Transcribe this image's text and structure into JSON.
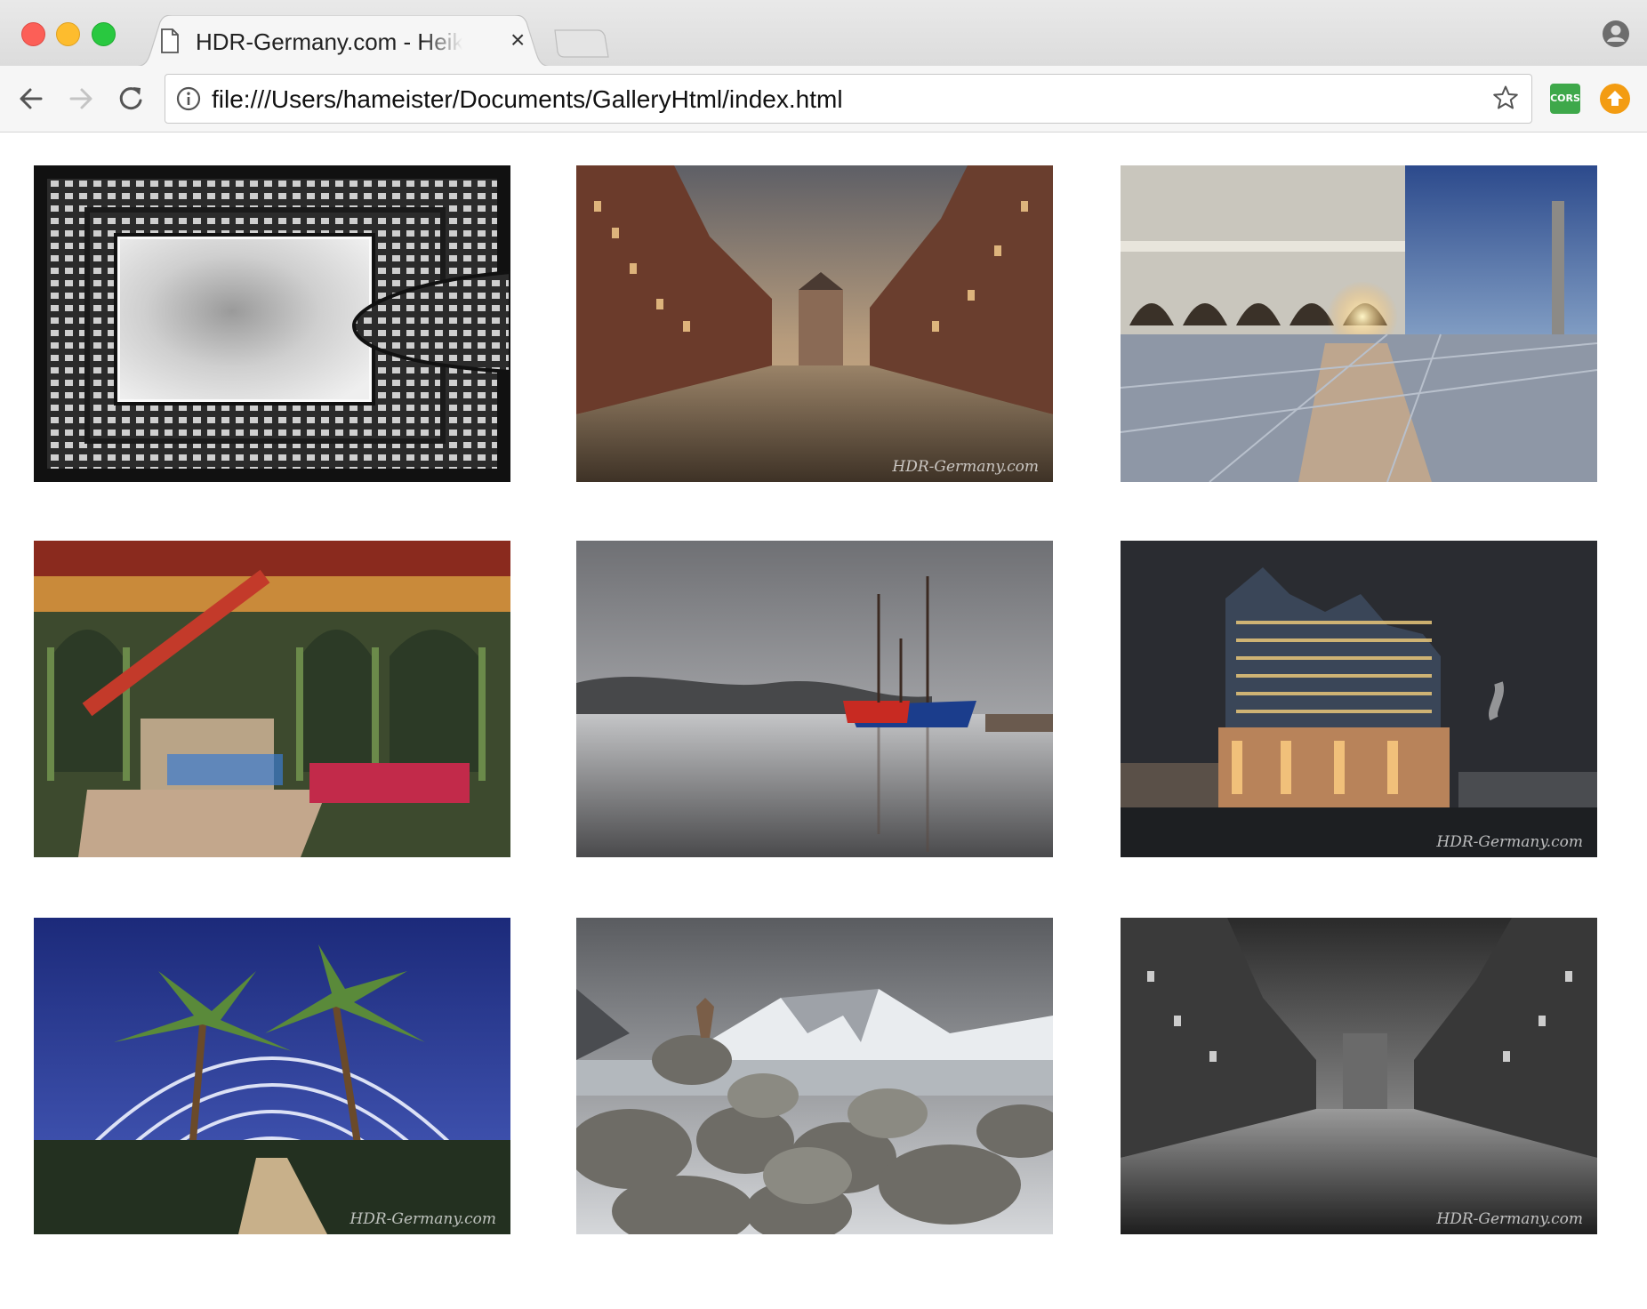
{
  "window": {
    "tab_title": "HDR-Germany.com - Heike Hameister",
    "tab_close": "×",
    "icons": [
      "page-icon",
      "close-icon",
      "profile-icon",
      "back-icon",
      "forward-icon",
      "reload-icon",
      "info-icon",
      "star-icon",
      "cors-extension-icon",
      "upload-extension-icon"
    ]
  },
  "toolbar": {
    "url": "file:///Users/hameister/Documents/GalleryHtml/index.html",
    "cors_label": "CORS"
  },
  "gallery": {
    "watermark": "HDR-Germany.com"
  },
  "colors": {
    "close": "#fc5f57",
    "minimize": "#fdbc2e",
    "maximize": "#29c840",
    "cors": "#3ea84a",
    "update": "#f39c12"
  }
}
